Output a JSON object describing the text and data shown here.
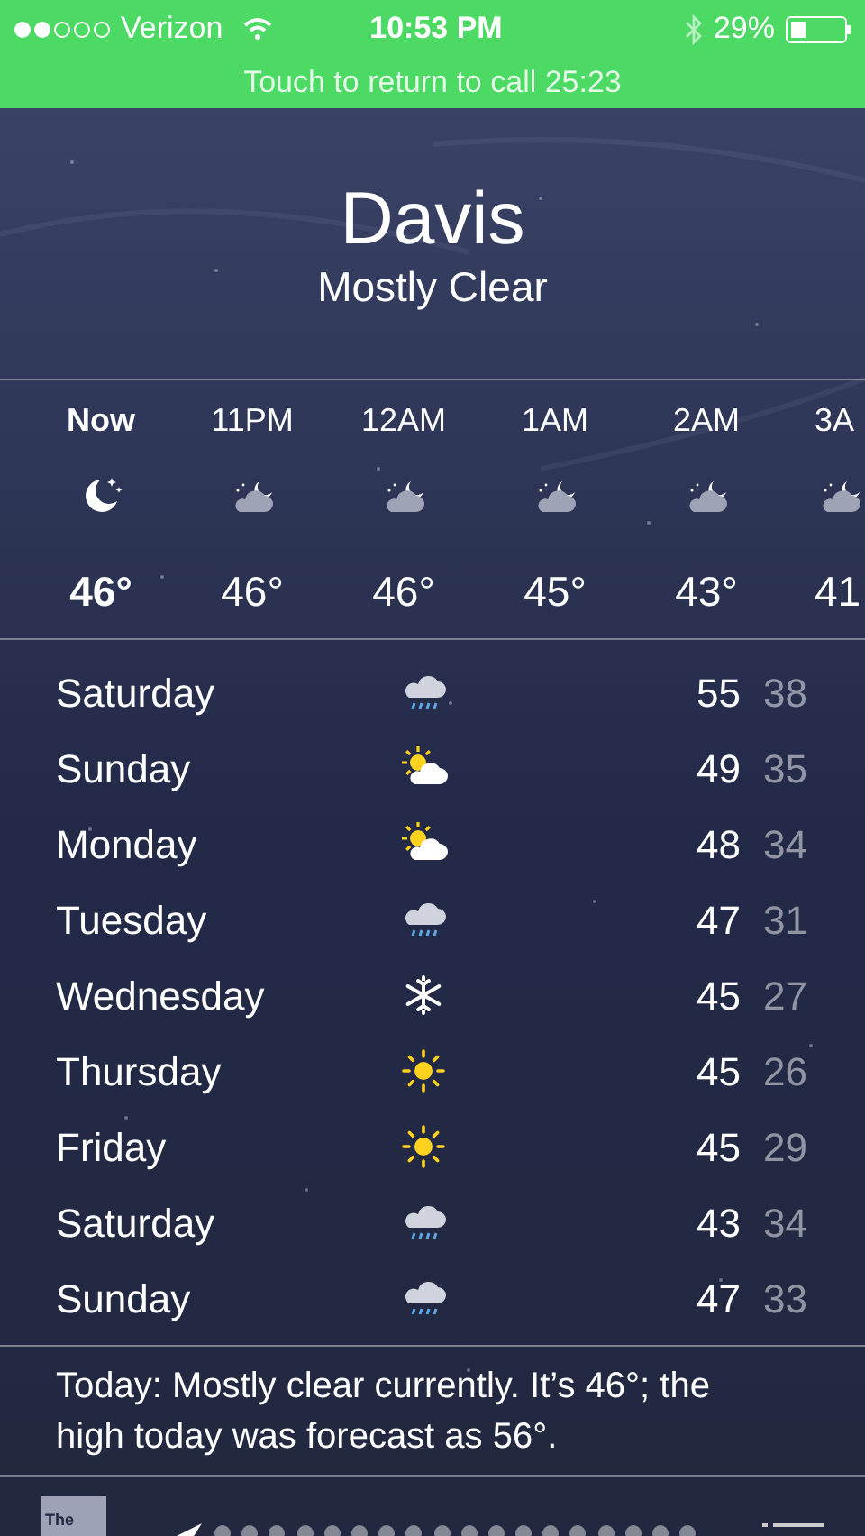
{
  "status_bar": {
    "carrier": "Verizon",
    "time": "10:53 PM",
    "battery": "29%"
  },
  "call_banner": "Touch to return to call 25:23",
  "location": {
    "city": "Davis",
    "condition": "Mostly Clear"
  },
  "hourly": [
    {
      "time": "Now",
      "kind": "moon",
      "temp": "46°",
      "current": true
    },
    {
      "time": "11PM",
      "kind": "cloud-moon",
      "temp": "46°",
      "current": false
    },
    {
      "time": "12AM",
      "kind": "cloud-moon",
      "temp": "46°",
      "current": false
    },
    {
      "time": "1AM",
      "kind": "cloud-moon",
      "temp": "45°",
      "current": false
    },
    {
      "time": "2AM",
      "kind": "cloud-moon",
      "temp": "43°",
      "current": false
    },
    {
      "time": "3A",
      "kind": "cloud-moon",
      "temp": "41",
      "current": false
    }
  ],
  "daily": [
    {
      "day": "Saturday",
      "kind": "rain",
      "high": "55",
      "low": "38"
    },
    {
      "day": "Sunday",
      "kind": "sun-cloud",
      "high": "49",
      "low": "35"
    },
    {
      "day": "Monday",
      "kind": "sun-cloud",
      "high": "48",
      "low": "34"
    },
    {
      "day": "Tuesday",
      "kind": "rain",
      "high": "47",
      "low": "31"
    },
    {
      "day": "Wednesday",
      "kind": "snow",
      "high": "45",
      "low": "27"
    },
    {
      "day": "Thursday",
      "kind": "sun",
      "high": "45",
      "low": "26"
    },
    {
      "day": "Friday",
      "kind": "sun",
      "high": "45",
      "low": "29"
    },
    {
      "day": "Saturday",
      "kind": "rain",
      "high": "43",
      "low": "34"
    },
    {
      "day": "Sunday",
      "kind": "rain",
      "high": "47",
      "low": "33"
    }
  ],
  "summary": "Today: Mostly clear currently. It’s 46°; the high today was forecast as 56°.",
  "toolbar": {
    "logo_text": "The"
  }
}
